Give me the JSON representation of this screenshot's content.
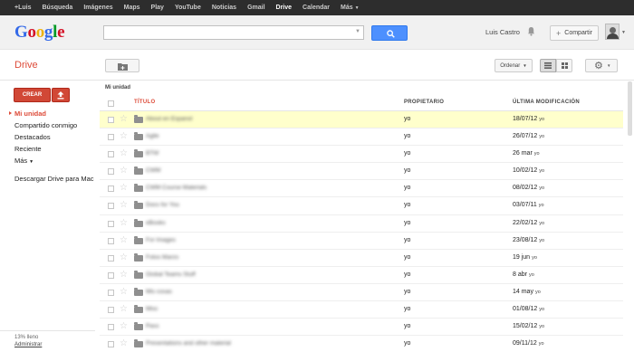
{
  "topbar": {
    "links": [
      {
        "label": "+Luis",
        "active": false
      },
      {
        "label": "Búsqueda",
        "active": false
      },
      {
        "label": "Imágenes",
        "active": false
      },
      {
        "label": "Maps",
        "active": false
      },
      {
        "label": "Play",
        "active": false
      },
      {
        "label": "YouTube",
        "active": false
      },
      {
        "label": "Noticias",
        "active": false
      },
      {
        "label": "Gmail",
        "active": false
      },
      {
        "label": "Drive",
        "active": true
      },
      {
        "label": "Calendar",
        "active": false
      },
      {
        "label": "Más",
        "active": false
      }
    ]
  },
  "header": {
    "logo": "Google",
    "search_value": "",
    "user_name": "Luis Castro",
    "share_label": "Compartir"
  },
  "toolbar": {
    "app_title": "Drive",
    "sort_label": "Ordenar"
  },
  "sidebar": {
    "create_label": "CREAR",
    "items": [
      {
        "label": "Mi unidad",
        "active": true
      },
      {
        "label": "Compartido conmigo",
        "active": false
      },
      {
        "label": "Destacados",
        "active": false
      },
      {
        "label": "Reciente",
        "active": false
      },
      {
        "label": "Más",
        "active": false
      }
    ],
    "download_label": "Descargar Drive para Mac",
    "quota": "13% lleno",
    "manage_label": "Administrar"
  },
  "main": {
    "breadcrumb": "Mi unidad",
    "columns": {
      "title": "TÍTULO",
      "owner": "PROPIETARIO",
      "modified": "ÚLTIMA MODIFICACIÓN"
    },
    "rows": [
      {
        "name": "About en Espanol",
        "owner": "yo",
        "date": "18/07/12",
        "by": "yo"
      },
      {
        "name": "Agile",
        "owner": "yo",
        "date": "26/07/12",
        "by": "yo"
      },
      {
        "name": "BTW",
        "owner": "yo",
        "date": "26 mar",
        "by": "yo"
      },
      {
        "name": "CWM",
        "owner": "yo",
        "date": "10/02/12",
        "by": "yo"
      },
      {
        "name": "CWM Course Materials",
        "owner": "yo",
        "date": "08/02/12",
        "by": "yo"
      },
      {
        "name": "Docs for You",
        "owner": "yo",
        "date": "03/07/11",
        "by": "yo"
      },
      {
        "name": "eBooks",
        "owner": "yo",
        "date": "22/02/12",
        "by": "yo"
      },
      {
        "name": "For Images",
        "owner": "yo",
        "date": "23/08/12",
        "by": "yo"
      },
      {
        "name": "Fotos Marzo",
        "owner": "yo",
        "date": "19 jun",
        "by": "yo"
      },
      {
        "name": "Global Teams Stuff",
        "owner": "yo",
        "date": "8 abr",
        "by": "yo"
      },
      {
        "name": "Mis cosas",
        "owner": "yo",
        "date": "14 may",
        "by": "yo"
      },
      {
        "name": "Misc",
        "owner": "yo",
        "date": "01/08/12",
        "by": "yo"
      },
      {
        "name": "Pass",
        "owner": "yo",
        "date": "15/02/12",
        "by": "yo"
      },
      {
        "name": "Presentations and other material",
        "owner": "yo",
        "date": "09/11/12",
        "by": "yo"
      }
    ]
  },
  "colors": {
    "accent": "#dd4b39",
    "search_button": "#4d90fe",
    "highlight_row": "#ffffcc"
  }
}
